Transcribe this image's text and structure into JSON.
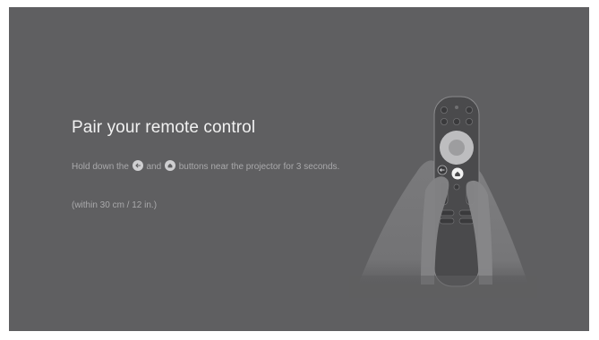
{
  "pairing": {
    "title": "Pair your remote control",
    "instruction": {
      "before_back": "Hold down the",
      "between": "and",
      "after_home": "buttons near the projector for 3 seconds."
    },
    "note": "(within 30 cm / 12 in.)"
  },
  "icons": {
    "back": "back-arrow-icon",
    "home": "home-icon"
  },
  "colors": {
    "background": "#5f5f61",
    "title": "#f1f1f1",
    "body_text": "#a9a9ab"
  }
}
